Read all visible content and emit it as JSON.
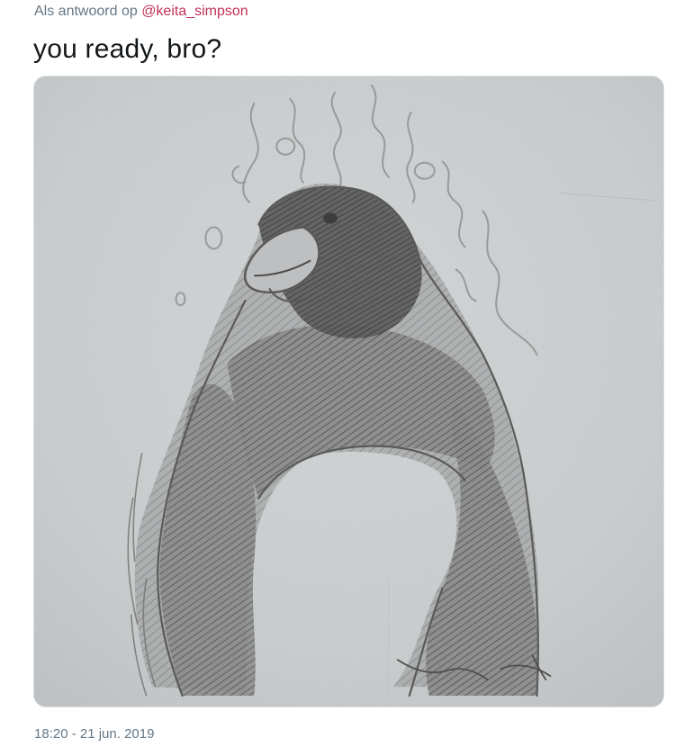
{
  "reply": {
    "prefix": "Als antwoord op",
    "mention": "@keita_simpson"
  },
  "tweet": {
    "text": "you ready, bro?",
    "timestamp": "18:20 - 21 jun. 2019"
  },
  "media": {
    "kind": "photo",
    "subject": "pencil-sketch",
    "colors": {
      "paper": "#c9cccd",
      "graphite": "#6a6a6a"
    }
  }
}
